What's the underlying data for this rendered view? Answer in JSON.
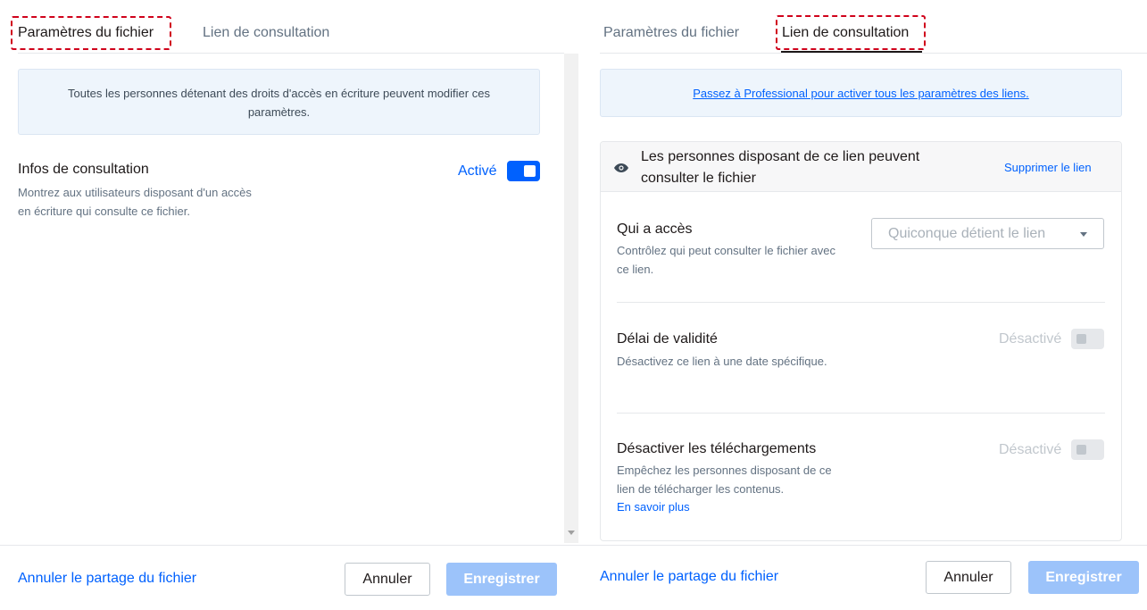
{
  "left_panel": {
    "tabs": [
      "Paramètres du fichier",
      "Lien de consultation"
    ],
    "info_text": "Toutes les personnes détenant des droits d'accès en écriture peuvent modifier ces paramètres.",
    "setting": {
      "title": "Infos de consultation",
      "description": "Montrez aux utilisateurs disposant d'un accès en écriture qui consulte ce fichier.",
      "toggle_label": "Activé",
      "toggle_on": true
    },
    "footer": {
      "unshare_link": "Annuler le partage du fichier",
      "cancel_label": "Annuler",
      "save_label": "Enregistrer"
    }
  },
  "right_panel": {
    "tabs": [
      "Paramètres du fichier",
      "Lien de consultation"
    ],
    "upgrade_link": "Passez à Professional pour activer tous les paramètres des liens.",
    "link_card": {
      "header_text": "Les personnes disposant de ce lien peuvent consulter le fichier",
      "remove_link": "Supprimer le lien",
      "access": {
        "title": "Qui a accès",
        "description": "Contrôlez qui peut consulter le fichier avec ce lien.",
        "select_value": "Quiconque détient le lien"
      },
      "expiry": {
        "title": "Délai de validité",
        "description": "Désactivez ce lien à une date spécifique.",
        "toggle_label": "Désactivé",
        "toggle_on": false
      },
      "downloads": {
        "title": "Désactiver les téléchargements",
        "description": "Empêchez les personnes disposant de ce lien de télécharger les contenus.",
        "learn_more": "En savoir plus",
        "toggle_label": "Désactivé",
        "toggle_on": false
      }
    },
    "footer": {
      "unshare_link": "Annuler le partage du fichier",
      "cancel_label": "Annuler",
      "save_label": "Enregistrer"
    }
  },
  "colors": {
    "accent": "#0061fe",
    "annotation_dashed": "#d0021b",
    "save_disabled": "#9cc3fa",
    "info_bg": "#eef5fc"
  },
  "icons": {
    "eye": "eye-icon",
    "caret": "chevron-down-icon"
  }
}
